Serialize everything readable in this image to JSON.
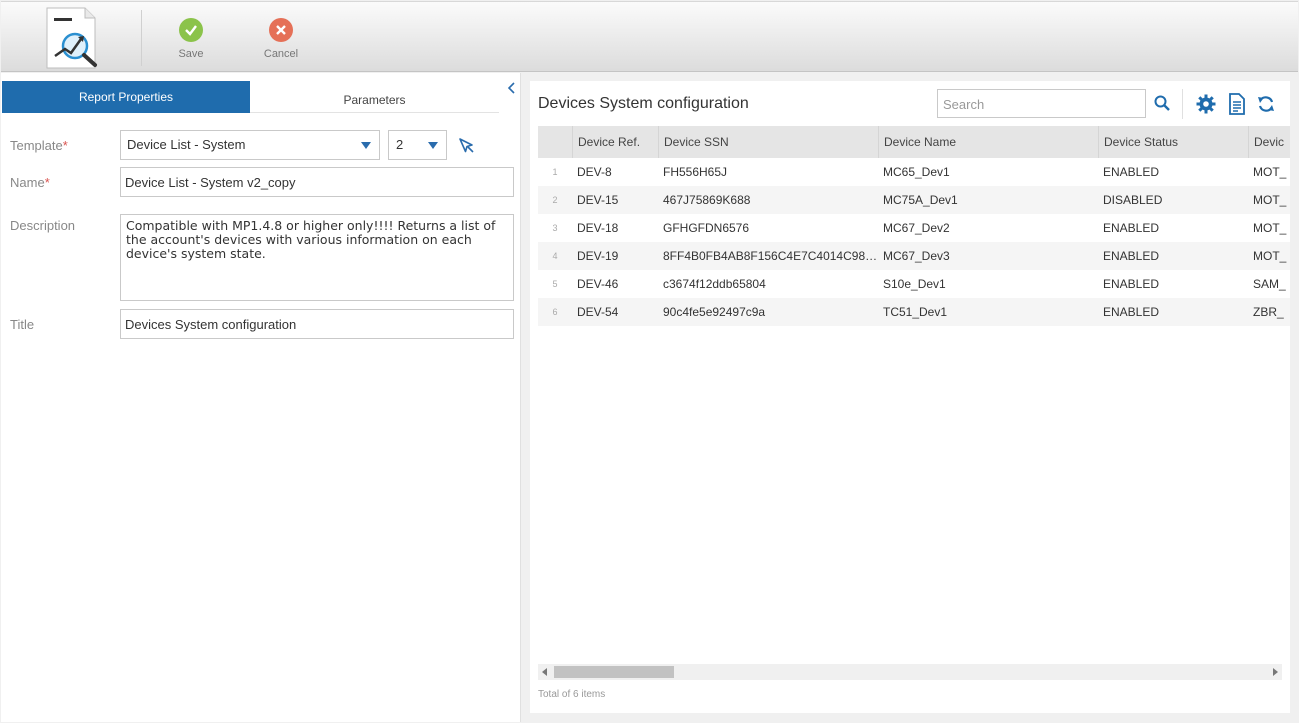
{
  "toolbar": {
    "save_label": "Save",
    "cancel_label": "Cancel",
    "save_color": "#8bc34a",
    "cancel_color": "#e57057"
  },
  "left_panel": {
    "tabs": [
      {
        "label": "Report Properties",
        "active": true
      },
      {
        "label": "Parameters",
        "active": false
      }
    ],
    "template": {
      "label": "Template",
      "required_mark": "*",
      "value": "Device List - System",
      "version": "2"
    },
    "name": {
      "label": "Name",
      "required_mark": "*",
      "value": "Device List - System v2_copy"
    },
    "description": {
      "label": "Description",
      "value": "Compatible with MP1.4.8 or higher only!!!! Returns a list of the account's devices with various information on each device's system state."
    },
    "title": {
      "label": "Title",
      "value": "Devices System configuration"
    }
  },
  "right_panel": {
    "title": "Devices System configuration",
    "search_placeholder": "Search",
    "columns": [
      "Device Ref.",
      "Device SSN",
      "Device Name",
      "Device Status",
      "Devic"
    ],
    "rows": [
      {
        "num": "1",
        "ref": "DEV-8",
        "ssn": "FH556H65J",
        "name": "MC65_Dev1",
        "status": "ENABLED",
        "extra": "MOT_"
      },
      {
        "num": "2",
        "ref": "DEV-15",
        "ssn": "467J75869K688",
        "name": "MC75A_Dev1",
        "status": "DISABLED",
        "extra": "MOT_"
      },
      {
        "num": "3",
        "ref": "DEV-18",
        "ssn": "GFHGFDN6576",
        "name": "MC67_Dev2",
        "status": "ENABLED",
        "extra": "MOT_"
      },
      {
        "num": "4",
        "ref": "DEV-19",
        "ssn": "8FF4B0FB4AB8F156C4E7C4014C98E…",
        "name": "MC67_Dev3",
        "status": "ENABLED",
        "extra": "MOT_"
      },
      {
        "num": "5",
        "ref": "DEV-46",
        "ssn": "c3674f12ddb65804",
        "name": "S10e_Dev1",
        "status": "ENABLED",
        "extra": "SAM_"
      },
      {
        "num": "6",
        "ref": "DEV-54",
        "ssn": "90c4fe5e92497c9a",
        "name": "TC51_Dev1",
        "status": "ENABLED",
        "extra": "ZBR_"
      }
    ],
    "footer": "Total of 6 items",
    "accent_color": "#1f6cad"
  }
}
